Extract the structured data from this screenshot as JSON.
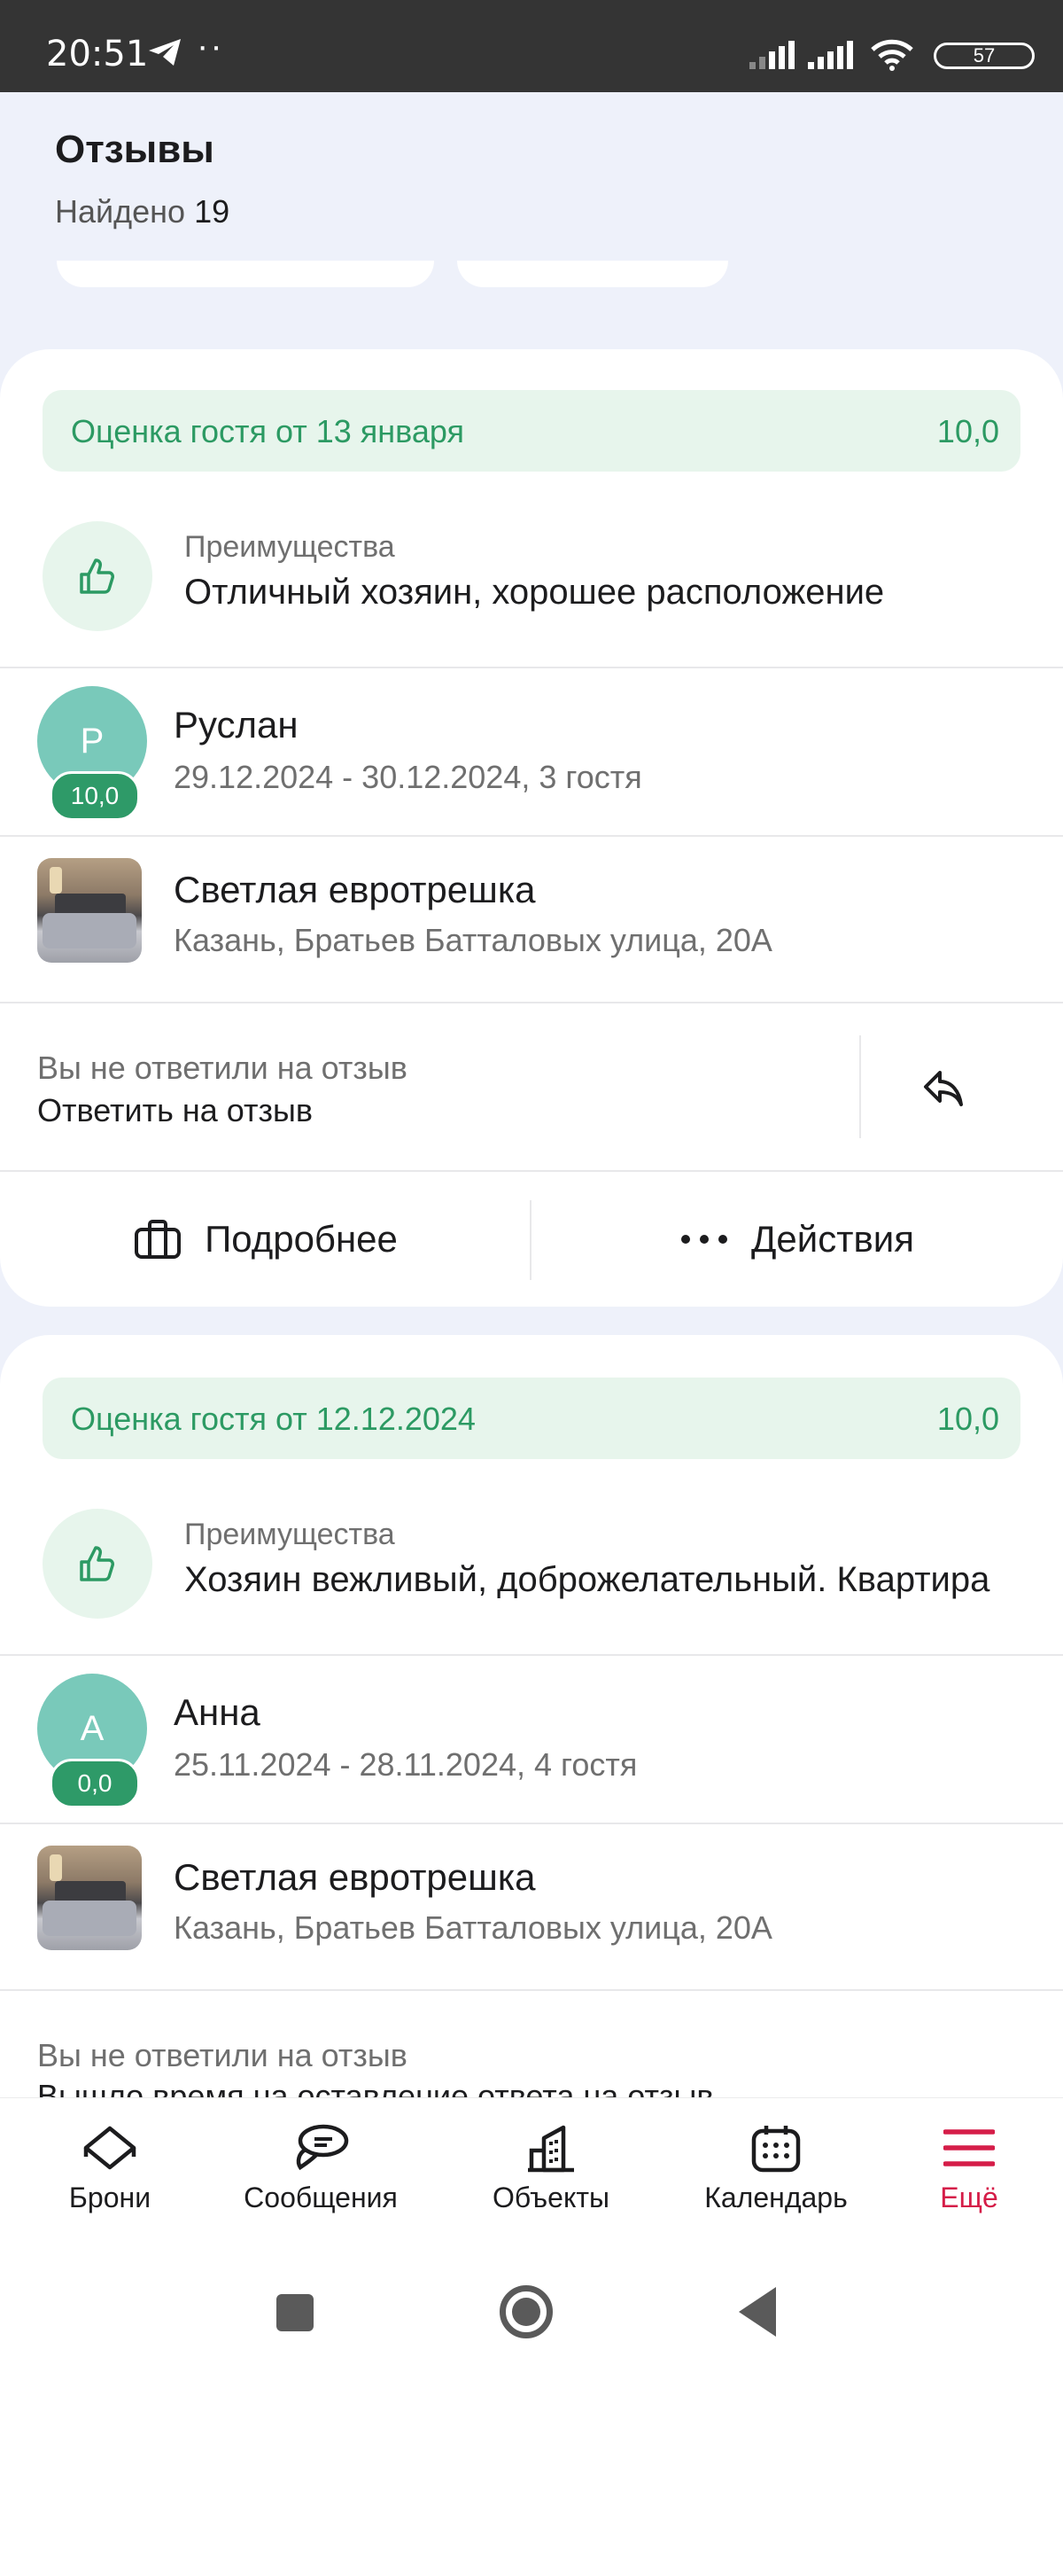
{
  "status_bar": {
    "time": "20:51",
    "dots": "··",
    "battery": "57"
  },
  "header": {
    "title": "Отзывы",
    "found_label": "Найдено",
    "found_count": "19"
  },
  "reviews": [
    {
      "rating_label": "Оценка гостя от 13 января",
      "rating_value": "10,0",
      "advantages_label": "Преимущества",
      "advantages_text": "Отличный хозяин, хорошее расположение",
      "guest_initial": "Р",
      "guest_score": "10,0",
      "guest_name": "Руслан",
      "stay": "29.12.2024 - 30.12.2024, 3 гостя",
      "property_name": "Светлая евротрешка",
      "property_address": "Казань, Братьев Батталовых улица, 20А",
      "reply_status": "Вы не ответили на отзыв",
      "reply_action": "Ответить на отзыв",
      "details_label": "Подробнее",
      "actions_label": "Действия"
    },
    {
      "rating_label": "Оценка гостя от 12.12.2024",
      "rating_value": "10,0",
      "advantages_label": "Преимущества",
      "advantages_text": "Хозяин вежливый, доброжелательный. Квартира",
      "guest_initial": "А",
      "guest_score": "0,0",
      "guest_name": "Анна",
      "stay": "25.11.2024 - 28.11.2024, 4 гостя",
      "property_name": "Светлая евротрешка",
      "property_address": "Казань, Братьев Батталовых улица, 20А",
      "reply_status": "Вы не ответили на отзыв",
      "reply_action": "Вышло время на оставление ответа на отзыв"
    }
  ],
  "bottom_nav": [
    {
      "label": "Брони",
      "icon": "house-icon"
    },
    {
      "label": "Сообщения",
      "icon": "chat-icon"
    },
    {
      "label": "Объекты",
      "icon": "buildings-icon"
    },
    {
      "label": "Календарь",
      "icon": "calendar-icon"
    },
    {
      "label": "Ещё",
      "icon": "menu-icon",
      "active": true
    }
  ],
  "colors": {
    "accent_green": "#2c9a63",
    "rating_bg": "#e7f5ec",
    "active_nav": "#d51d48",
    "page_bg": "#eef1fa"
  }
}
